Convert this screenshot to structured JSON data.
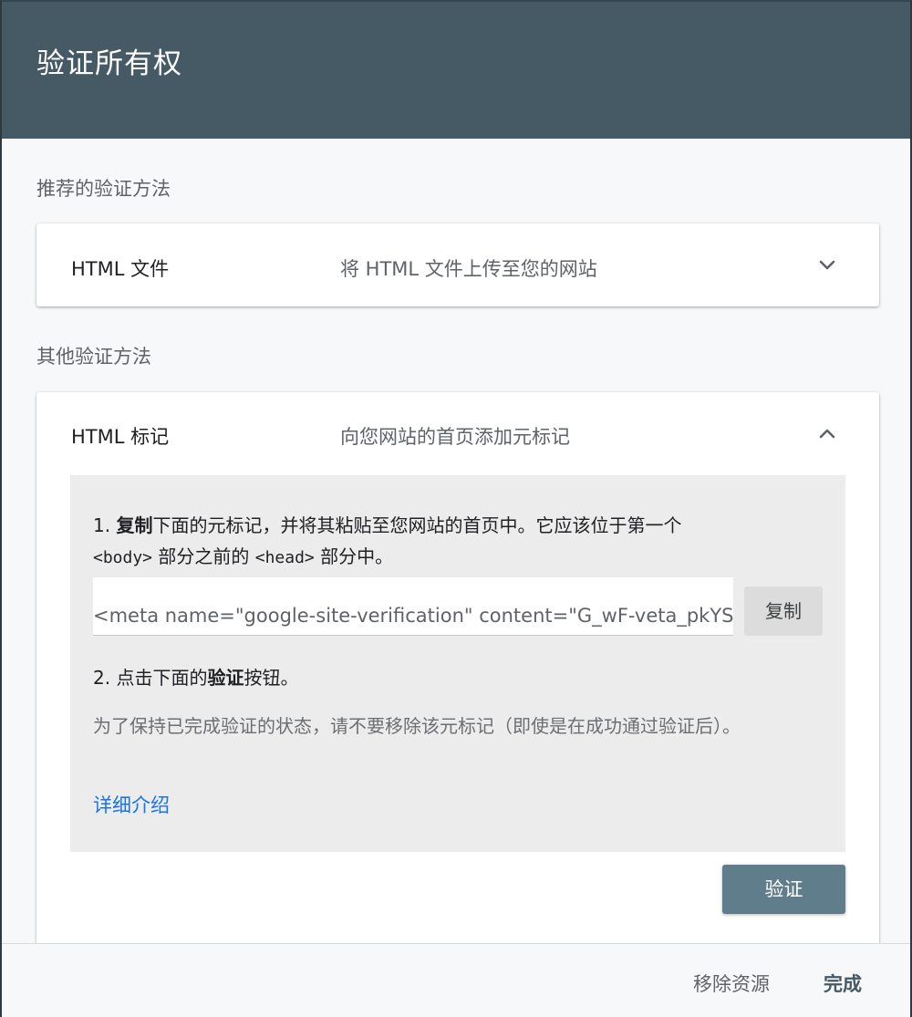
{
  "dialog": {
    "title": "验证所有权"
  },
  "recommended": {
    "label": "推荐的验证方法",
    "method": {
      "name": "HTML 文件",
      "description": "将 HTML 文件上传至您的网站",
      "icon": "chevron-down-icon"
    }
  },
  "other": {
    "label": "其他验证方法",
    "method": {
      "name": "HTML 标记",
      "description": "向您网站的首页添加元标记",
      "icon": "chevron-up-icon",
      "step1": {
        "num": "1.",
        "bold": "复制",
        "text_a": "下面的元标记，并将其粘贴至您网站的首页中。它应该位于第一个",
        "code_body": "<body>",
        "text_b": "部分之前的",
        "code_head": "<head>",
        "text_c": "部分中。"
      },
      "meta_tag_value": "<meta name=\"google-site-verification\" content=\"G_wF-veta_pkYS",
      "copy_label": "复制",
      "step2": {
        "num": "2.",
        "text_a": "点击下面的",
        "bold": "验证",
        "text_b": "按钮。"
      },
      "note": "为了保持已完成验证的状态，请不要移除该元标记（即使是在成功通过验证后）。",
      "learn_more": "详细介绍",
      "verify_label": "验证"
    }
  },
  "footer": {
    "remove_label": "移除资源",
    "done_label": "完成"
  },
  "colors": {
    "header": "#455a64",
    "verify_button": "#607d8b",
    "link": "#1a73e8"
  }
}
